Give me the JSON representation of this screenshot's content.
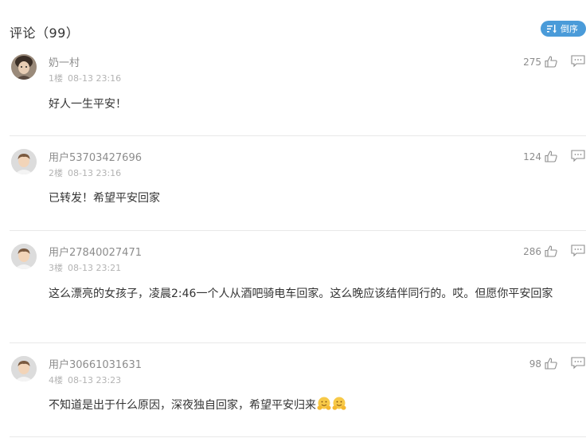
{
  "header": {
    "title": "评论（99）",
    "sort_label": "倒序"
  },
  "comments": [
    {
      "username": "奶一村",
      "floor": "1楼",
      "time": "08-13 23:16",
      "likes": "275",
      "text": "好人一生平安！",
      "avatar": "photo"
    },
    {
      "username": "用户53703427696",
      "floor": "2楼",
      "time": "08-13 23:16",
      "likes": "124",
      "text": "已转发！希望平安回家",
      "avatar": "default"
    },
    {
      "username": "用户27840027471",
      "floor": "3楼",
      "time": "08-13 23:21",
      "likes": "286",
      "text": "这么漂亮的女孩子，凌晨2:46一个人从酒吧骑电车回家。这么晚应该结伴同行的。哎。但愿你平安回家",
      "avatar": "default"
    },
    {
      "username": "用户30661031631",
      "floor": "4楼",
      "time": "08-13 23:23",
      "likes": "98",
      "text": "不知道是出于什么原因，深夜独自回家，希望平安归来",
      "avatar": "default",
      "emojis": [
        "hug-emoji",
        "hug-emoji"
      ]
    }
  ],
  "colors": {
    "accent": "#4a9bd9",
    "meta": "#b3b3b3",
    "username": "#8c8c8c",
    "divider": "#e8e8e8"
  }
}
